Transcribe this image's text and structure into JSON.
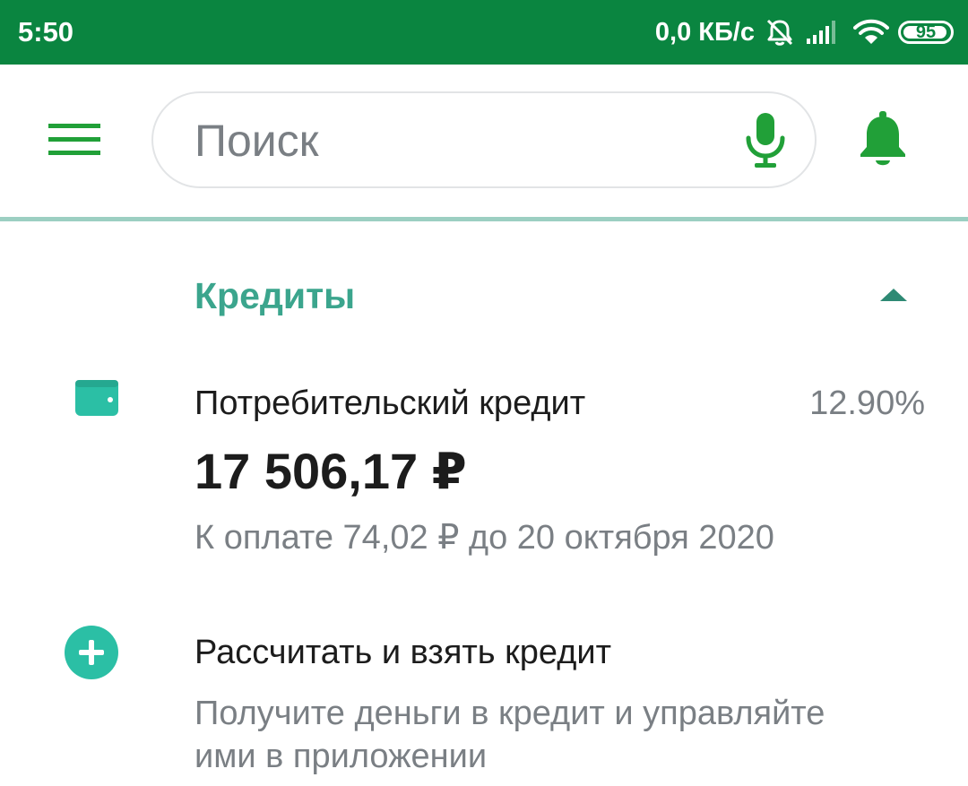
{
  "status_bar": {
    "time": "5:50",
    "network_speed": "0,0 КБ/с",
    "battery_level": "95",
    "battery_fraction": 0.95,
    "icons": [
      "alarm-off-icon",
      "signal-icon",
      "wifi-icon",
      "battery-icon"
    ]
  },
  "header": {
    "search_placeholder": "Поиск",
    "icons": [
      "menu-icon",
      "mic-icon",
      "bell-icon"
    ]
  },
  "credits_section": {
    "title": "Кредиты",
    "expanded": true,
    "loan": {
      "name": "Потребительский кредит",
      "rate": "12.90%",
      "amount": "17 506,17 ₽",
      "payment_info": "К оплате 74,02 ₽ до 20 октября 2020",
      "icon": "wallet-icon"
    },
    "new_credit": {
      "title": "Рассчитать и взять кредит",
      "description": "Получите деньги в кредит и управляйте ими в приложении",
      "icon": "plus-icon"
    }
  },
  "colors": {
    "status_bar": "#0a8540",
    "brand_green": "#21a038",
    "accent_teal": "#3ba58d",
    "icon_teal": "#2bbfa5",
    "divider": "#9ccfc2"
  }
}
